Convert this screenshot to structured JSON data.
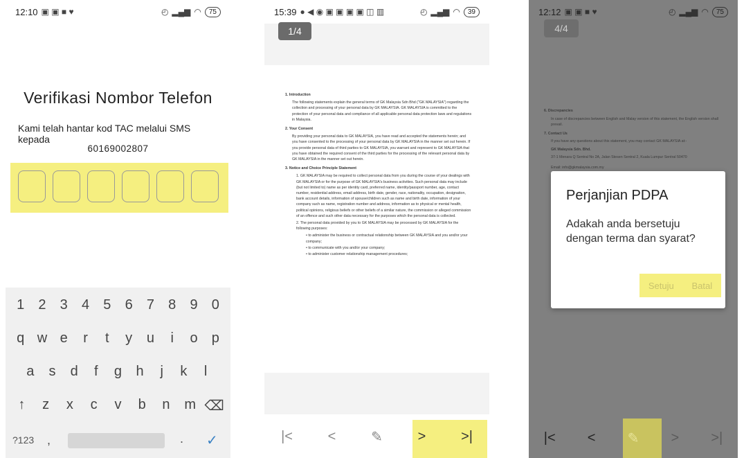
{
  "phone1": {
    "status": {
      "time": "12:10",
      "battery": "75"
    },
    "title": "Verifikasi Nombor Telefon",
    "message": "Kami telah hantar kod TAC melalui SMS kepada",
    "phone_number": "60169002807",
    "keyboard": {
      "row1": [
        "1",
        "2",
        "3",
        "4",
        "5",
        "6",
        "7",
        "8",
        "9",
        "0"
      ],
      "row2": [
        "q",
        "w",
        "e",
        "r",
        "t",
        "y",
        "u",
        "i",
        "o",
        "p"
      ],
      "row3": [
        "a",
        "s",
        "d",
        "f",
        "g",
        "h",
        "j",
        "k",
        "l"
      ],
      "row4": [
        "↑",
        "z",
        "x",
        "c",
        "v",
        "b",
        "n",
        "m",
        "⌫"
      ],
      "sym_key": "?123",
      "comma": ",",
      "period": ".",
      "enter": "✓"
    }
  },
  "phone2": {
    "status": {
      "time": "15:39",
      "battery": "39"
    },
    "page_badge": "1/4",
    "doc": {
      "s1_title": "1.  Introduction",
      "s1_text": "The following statements explain the general terms of GK Malaysia Sdn Bhd (\"GK MALAYSIA\") regarding the collection and processing of your personal data by GK MALAYSIA. GK MALAYSIA is committed to the protection of your personal data and compliance of all applicable personal data protection laws and regulations in Malaysia.",
      "s2_title": "2.  Your Consent",
      "s2_text": "By providing your personal data to GK MALAYSIA, you have read and accepted the statements herein; and you have consented to the processing of your personal data by GK MALAYSIA in the manner set out herein. If you provide personal data of third parties to GK MALAYSIA, you warrant and represent to GK MALAYSIA that you have obtained the required consent of the third parties for the processing of the relevant personal data by GK MALAYSIA in the manner set out herein.",
      "s3_title": "3.  Notice and Choice Principle Statement",
      "s3_item1": "1.  GK MALAYSIA may be required to collect personal data from you during the course of your dealings with GK MALAYSIA or for the purpose of GK MALAYSIA's business activities. Such personal data may include (but not limited to) name as per identity card, preferred name, identity/passport number, age, contact number, residential address, email address, birth date, gender, race, nationality, occupation, designation, bank account details, information of spouse/children such as name and birth date, information of your company such as name, registration number and address, information as to physical or mental health, political opinions, religious beliefs or other beliefs of a similar nature, the commission or alleged commission of an offence and such other data necessary for the purposes which the personal data is collected.",
      "s3_item2": "2.  The personal data provided by you to GK MALAYSIA may be processed by GK MALAYSIA for the following purposes:",
      "bullet1": "•  to administer the business or contractual relationship between GK MALAYSIA and you and/or your company;",
      "bullet2": "•  to communicate with you and/or your company;",
      "bullet3": "•  to administer customer relationship management procedures;"
    },
    "nav": {
      "first": "|<",
      "prev": "<",
      "next": ">",
      "last": ">|"
    }
  },
  "phone3": {
    "status": {
      "time": "12:12",
      "battery": "75"
    },
    "page_badge": "4/4",
    "doc": {
      "s6_title": "6.  Discrepancies",
      "s6_text": "In case of discrepancies between English and Malay version of this statement, the English version shall prevail.",
      "s7_title": "7.  Contact Us",
      "s7_text": "If you have any questions about this statement, you may contact GK MALAYSIA at:-",
      "company": "GK Malaysia Sdn. Bhd.",
      "address": "37-1 Menara Q Sentral No 2A, Jalan Stesen Sentral 2, Kuala Lumpur Sentral 50470",
      "email": "Email: info@gkmalaysia.com.my"
    },
    "dialog": {
      "title": "Perjanjian PDPA",
      "message": "Adakah anda bersetuju dengan terma dan syarat?",
      "agree": "Setuju",
      "cancel": "Batal"
    },
    "nav": {
      "first": "|<",
      "prev": "<",
      "next": ">",
      "last": ">|"
    }
  },
  "colors": {
    "highlight": "#f5ef80",
    "overlay": "#808080"
  }
}
